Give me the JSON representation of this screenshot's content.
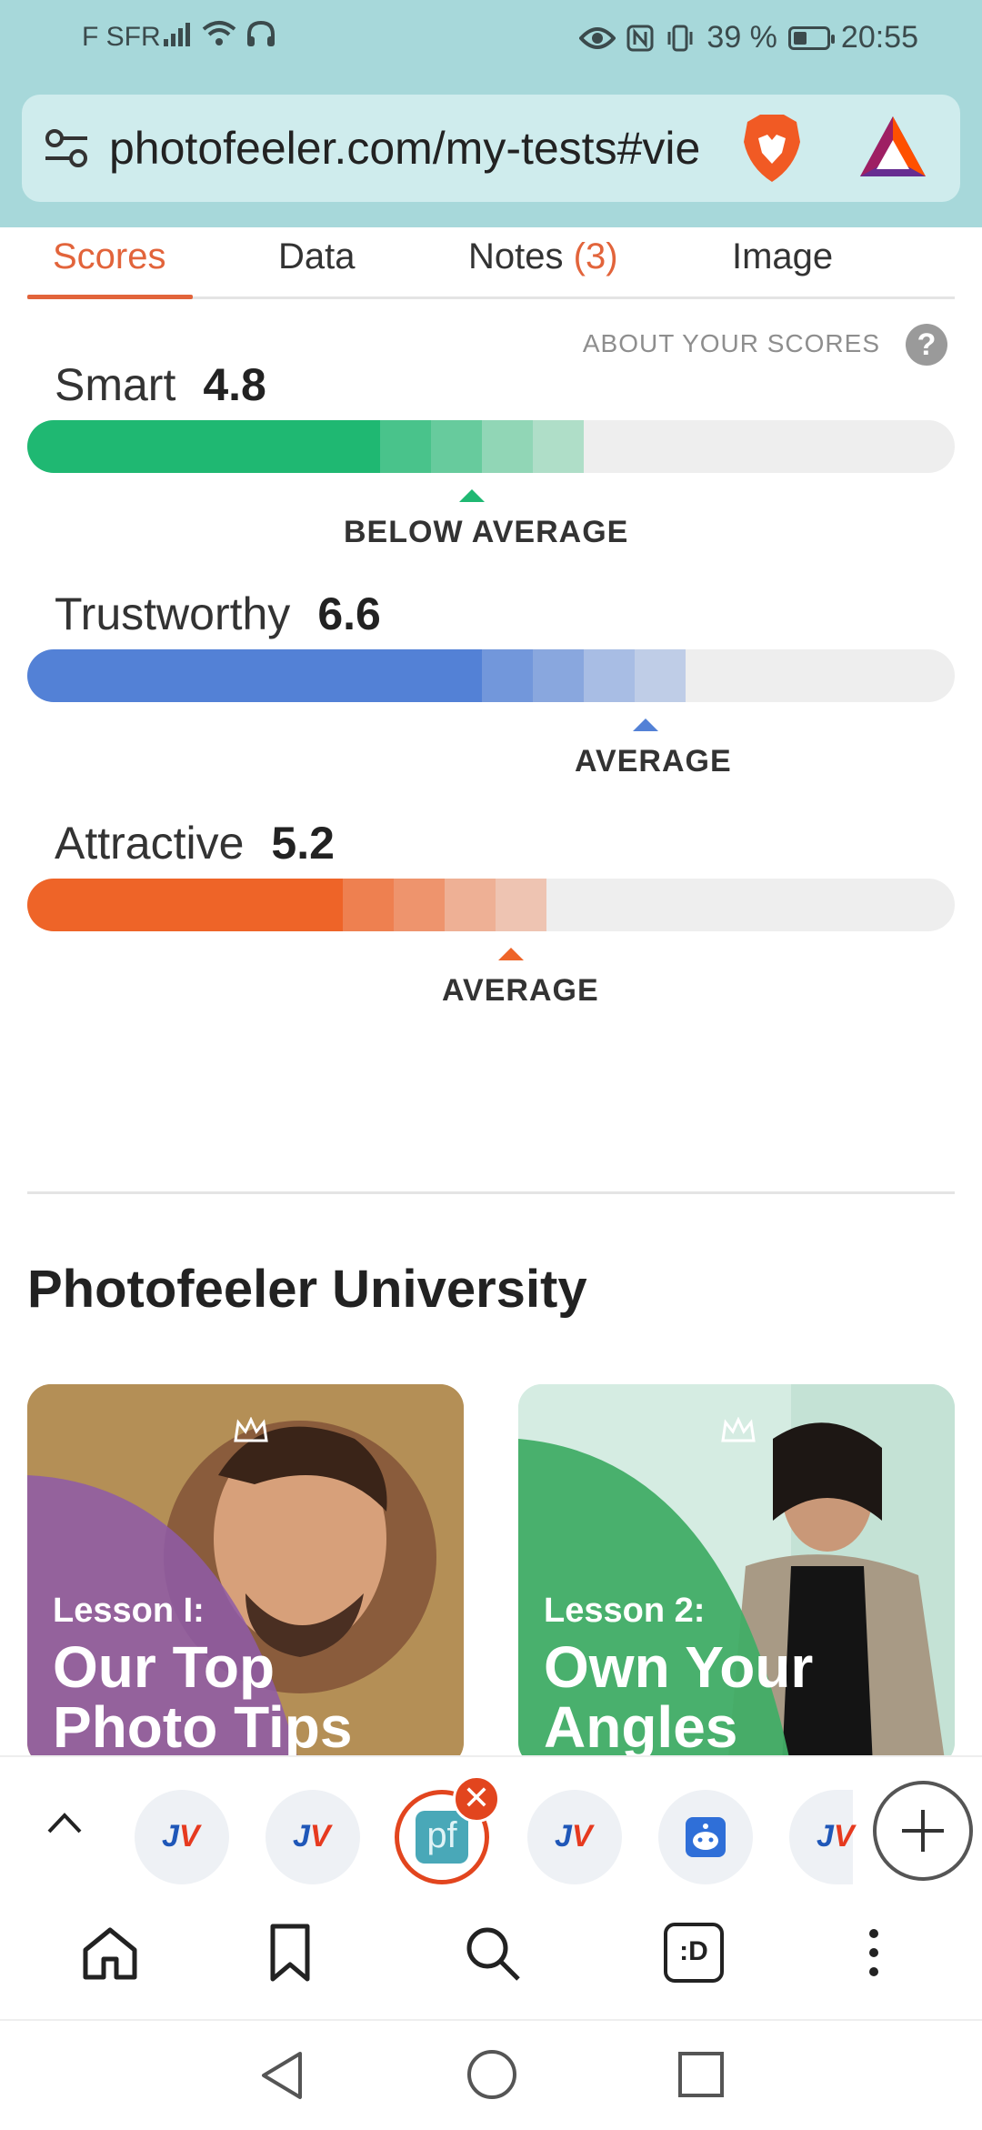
{
  "statusbar": {
    "carrier": "F SFR",
    "battery_percent": "39 %",
    "time": "20:55"
  },
  "browser": {
    "url": "photofeeler.com/my-tests#vie"
  },
  "tabs": {
    "scores": "Scores",
    "data": "Data",
    "notes": "Notes",
    "notes_count": "(3)",
    "image": "Image"
  },
  "about_scores": "ABOUT YOUR SCORES",
  "help_glyph": "?",
  "metrics": [
    {
      "label": "Smart",
      "score": "4.8",
      "verdict": "BELOW AVERAGE",
      "color": "#1fb872",
      "level": 0.56
    },
    {
      "label": "Trustworthy",
      "score": "6.6",
      "verdict": "AVERAGE",
      "color": "#5381d6",
      "level": 0.67
    },
    {
      "label": "Attractive",
      "score": "5.2",
      "verdict": "AVERAGE",
      "color": "#ee6428",
      "level": 0.52
    }
  ],
  "university": {
    "title": "Photofeeler University",
    "cards": [
      {
        "lesson": "Lesson I:",
        "title": "Our Top Photo Tips"
      },
      {
        "lesson": "Lesson 2:",
        "title": "Own Your Angles"
      }
    ]
  },
  "tabstrip": {
    "jv_text": "J",
    "jv_accent": "V",
    "pf_text": "pf",
    "close_glyph": "✕"
  },
  "nav": {
    "tabs_label": ":D"
  },
  "colors": {
    "accent": "#e2643b",
    "header_bg": "#a7d8da"
  }
}
